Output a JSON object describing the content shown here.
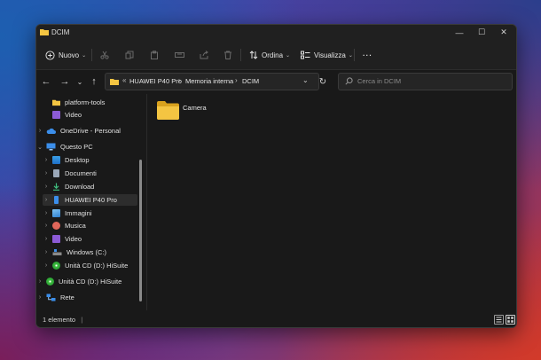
{
  "window": {
    "title": "DCIM",
    "controls": {
      "minimize": "—",
      "maximize": "☐",
      "close": "✕"
    }
  },
  "toolbar": {
    "new_label": "Nuovo",
    "sort_label": "Ordina",
    "view_label": "Visualizza",
    "more_label": "···"
  },
  "address": {
    "crumbs": [
      "HUAWEI P40 Pro",
      "Memoria interna",
      "DCIM"
    ],
    "separator": "›",
    "more_separator": "«"
  },
  "search": {
    "placeholder": "Cerca in DCIM"
  },
  "sidebar": {
    "items": [
      {
        "label": "platform-tools",
        "icon": "folder-icon",
        "level": 1,
        "chevron": ""
      },
      {
        "label": "Video",
        "icon": "video-icon",
        "level": 1,
        "chevron": ""
      },
      {
        "label": "OneDrive - Personal",
        "icon": "cloud-icon",
        "level": 0,
        "chevron": "›"
      },
      {
        "label": "Questo PC",
        "icon": "pc-icon",
        "level": 0,
        "chevron": "⌄"
      },
      {
        "label": "Desktop",
        "icon": "desktop-icon",
        "level": 1,
        "chevron": "›"
      },
      {
        "label": "Documenti",
        "icon": "document-icon",
        "level": 1,
        "chevron": "›"
      },
      {
        "label": "Download",
        "icon": "download-icon",
        "level": 1,
        "chevron": "›"
      },
      {
        "label": "HUAWEI P40 Pro",
        "icon": "phone-icon",
        "level": 1,
        "chevron": "›",
        "selected": true
      },
      {
        "label": "Immagini",
        "icon": "pictures-icon",
        "level": 1,
        "chevron": "›"
      },
      {
        "label": "Musica",
        "icon": "music-icon",
        "level": 1,
        "chevron": "›"
      },
      {
        "label": "Video",
        "icon": "video-icon",
        "level": 1,
        "chevron": "›"
      },
      {
        "label": "Windows (C:)",
        "icon": "drive-icon",
        "level": 1,
        "chevron": "›"
      },
      {
        "label": "Unità CD (D:) HiSuite",
        "icon": "cd-icon",
        "level": 1,
        "chevron": "›"
      },
      {
        "label": "Unità CD (D:) HiSuite",
        "icon": "cd-icon",
        "level": 0,
        "chevron": "›"
      },
      {
        "label": "Rete",
        "icon": "network-icon",
        "level": 0,
        "chevron": "›"
      }
    ]
  },
  "content": {
    "items": [
      {
        "name": "Camera",
        "icon": "folder-icon"
      }
    ]
  },
  "status": {
    "count_text": "1 elemento",
    "cursor": "|"
  },
  "colors": {
    "window_bg": "#191919",
    "toolbar_bg": "#202020",
    "folder_yellow": "#f4c542",
    "accent_blue": "#3b8eea"
  }
}
